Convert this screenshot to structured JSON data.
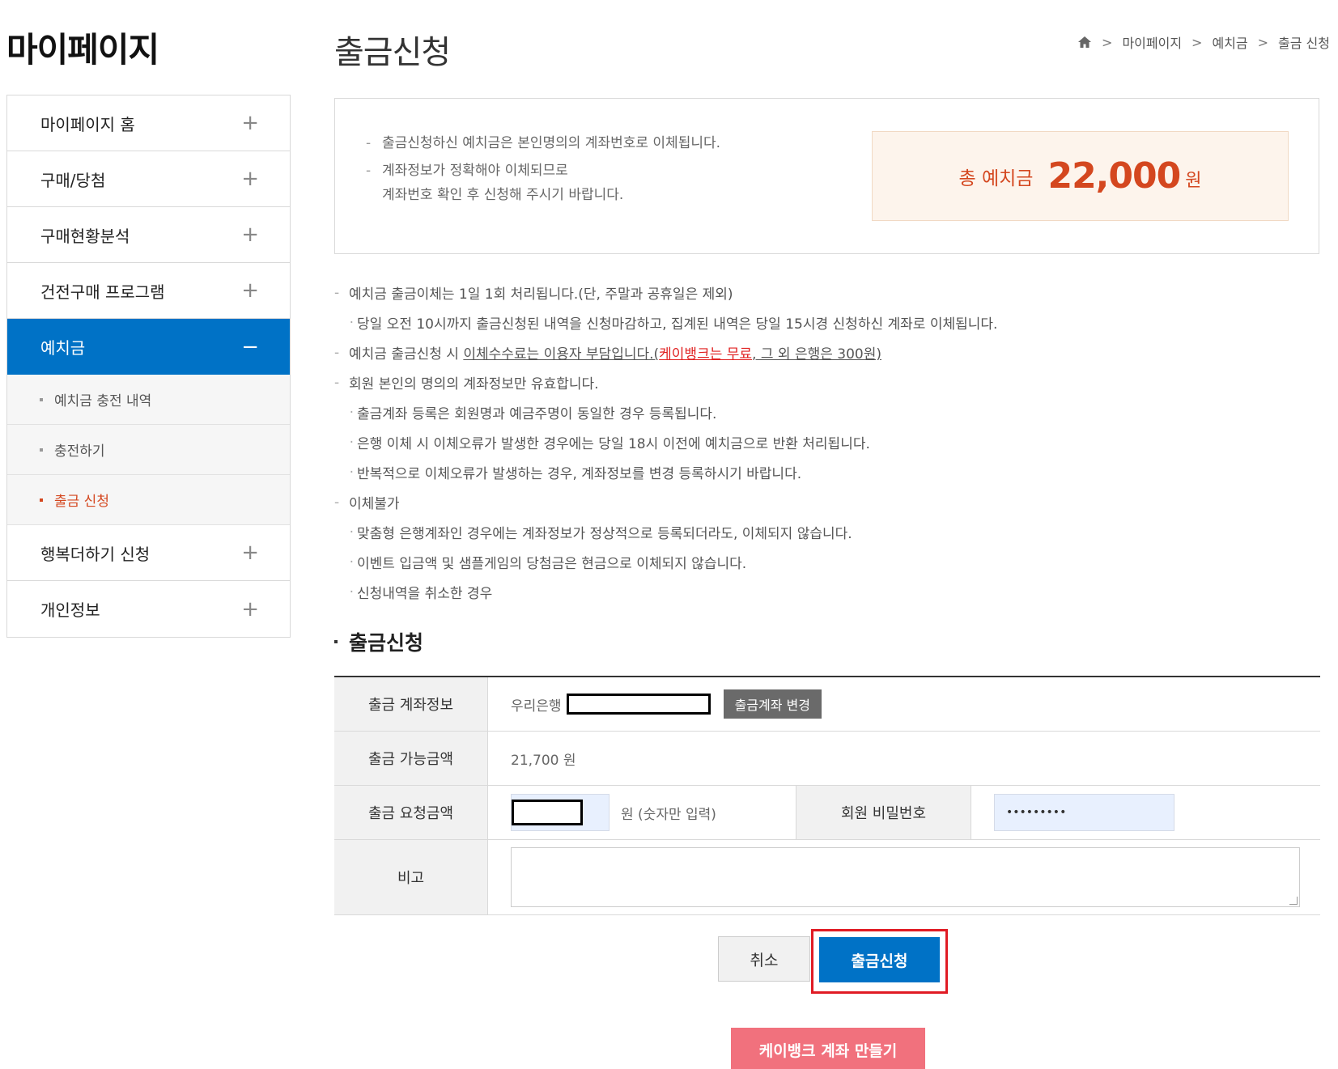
{
  "sidebar": {
    "title": "마이페이지",
    "items": [
      {
        "label": "마이페이지 홈",
        "toggle": "+"
      },
      {
        "label": "구매/당첨",
        "toggle": "+"
      },
      {
        "label": "구매현황분석",
        "toggle": "+"
      },
      {
        "label": "건전구매 프로그램",
        "toggle": "+"
      },
      {
        "label": "예치금",
        "toggle": "−"
      },
      {
        "label": "행복더하기 신청",
        "toggle": "+"
      },
      {
        "label": "개인정보",
        "toggle": "+"
      }
    ],
    "subitems": [
      {
        "label": "예치금 충전 내역"
      },
      {
        "label": "충전하기"
      },
      {
        "label": "출금 신청"
      }
    ]
  },
  "header": {
    "title": "출금신청",
    "breadcrumb": [
      "마이페이지",
      "예치금",
      "출금 신청"
    ]
  },
  "info": {
    "lines": [
      "출금신청하신 예치금은 본인명의의 계좌번호로 이체됩니다.",
      "계좌정보가 정확해야 이체되므로",
      "계좌번호 확인 후 신청해 주시기 바랍니다."
    ],
    "deposit_label": "총 예치금",
    "deposit_amount": "22,000",
    "deposit_unit": "원"
  },
  "notes": {
    "n1": "예치금 출금이체는 1일 1회 처리됩니다.(단, 주말과 공휴일은 제외)",
    "n1a": "당일 오전 10시까지 출금신청된 내역을 신청마감하고, 집계된 내역은 당일 15시경 신청하신 계좌로 이체됩니다.",
    "n2_pre": "예치금 출금신청 시 ",
    "n2_ul": "이체수수료는 이용자 부담입니다.(",
    "n2_red": "케이뱅크는 무료",
    "n2_post": ", 그 외 은행은 300원)",
    "n3": "회원 본인의 명의의 계좌정보만 유효합니다.",
    "n3a": "출금계좌 등록은 회원명과 예금주명이 동일한 경우 등록됩니다.",
    "n3b": "은행 이체 시 이체오류가 발생한 경우에는 당일 18시 이전에 예치금으로 반환 처리됩니다.",
    "n3c": "반복적으로 이체오류가 발생하는 경우, 계좌정보를 변경 등록하시기 바랍니다.",
    "n4": "이체불가",
    "n4a": "맞춤형 은행계좌인 경우에는 계좌정보가 정상적으로 등록되더라도, 이체되지 않습니다.",
    "n4b": "이벤트 입금액 및 샘플게임의 당첨금은 현금으로 이체되지 않습니다.",
    "n4c": "신청내역을 취소한 경우"
  },
  "form": {
    "section_title": "출금신청",
    "account_label": "출금 계좌정보",
    "bank_name": "우리은행",
    "change_button": "출금계좌 변경",
    "available_label": "출금 가능금액",
    "available_value": "21,700 원",
    "request_label": "출금 요청금액",
    "request_unit": "원  (숫자만 입력)",
    "password_label": "회원 비밀번호",
    "password_value": "•••••••••",
    "memo_label": "비고"
  },
  "buttons": {
    "cancel": "취소",
    "submit": "출금신청",
    "kbank": "케이뱅크 계좌 만들기"
  },
  "colors": {
    "accent": "#0072c6",
    "deposit": "#d4471f",
    "highlight": "#e01b24",
    "kbank": "#f1717d"
  }
}
